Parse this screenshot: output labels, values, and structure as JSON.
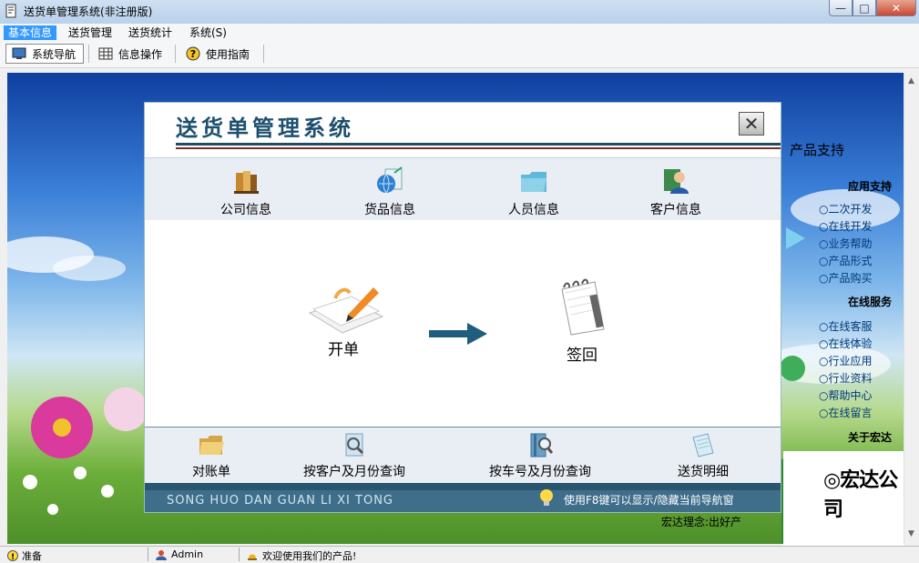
{
  "window": {
    "title": "送货单管理系统(非注册版)",
    "controls": {
      "minimize": "—",
      "maximize": "□",
      "close": "✕"
    }
  },
  "menu": {
    "items": [
      {
        "label": "基本信息",
        "active": true
      },
      {
        "label": "送货管理",
        "active": false
      },
      {
        "label": "送货统计",
        "active": false
      },
      {
        "label": "系统(S)",
        "active": false
      }
    ]
  },
  "toolbar": {
    "items": [
      {
        "label": "系统导航",
        "icon": "monitor-icon",
        "selected": true
      },
      {
        "label": "信息操作",
        "icon": "grid-icon",
        "selected": false
      },
      {
        "label": "使用指南",
        "icon": "help-icon",
        "selected": false
      }
    ]
  },
  "dialog": {
    "title": "送货单管理系统",
    "close": "✕",
    "top_nav": [
      {
        "label": "公司信息",
        "icon": "books-icon"
      },
      {
        "label": "货品信息",
        "icon": "globe-icon"
      },
      {
        "label": "人员信息",
        "icon": "folder-icon"
      },
      {
        "label": "客户信息",
        "icon": "person-icon"
      }
    ],
    "flow": {
      "start": {
        "label": "开单",
        "icon": "pen-paper-icon"
      },
      "end": {
        "label": "签回",
        "icon": "notepad-icon"
      }
    },
    "bottom_nav": [
      {
        "label": "对账单",
        "icon": "folder-open-icon"
      },
      {
        "label": "按客户及月份查询",
        "icon": "search-doc-icon"
      },
      {
        "label": "按车号及月份查询",
        "icon": "search-book-icon"
      },
      {
        "label": "送货明细",
        "icon": "document-icon"
      }
    ],
    "footer": {
      "slogan": "SONG HUO DAN GUAN LI XI TONG",
      "hint": "使用F8键可以显示/隐藏当前导航窗"
    }
  },
  "sidebar": {
    "title": "产品支持",
    "sections": [
      {
        "heading": "应用支持",
        "items": [
          "二次开发",
          "在线开发",
          "业务帮助",
          "产品形式",
          "产品购买"
        ]
      },
      {
        "heading": "在线服务",
        "items": [
          "在线客服",
          "在线体验",
          "行业应用",
          "行业资料",
          "帮助中心",
          "在线留言"
        ]
      }
    ],
    "about": "关于宏达",
    "company_logo": "◎宏达公司",
    "motto": "宏达理念:出好产"
  },
  "status": {
    "state": "准备",
    "user": "Admin",
    "welcome": "欢迎使用我们的产品!"
  },
  "colors": {
    "menu_active": "#3399ff",
    "dialog_title": "#1d4f6e",
    "footer_band": "#3f6e8a",
    "flow_arrow": "#1f5e7f"
  }
}
